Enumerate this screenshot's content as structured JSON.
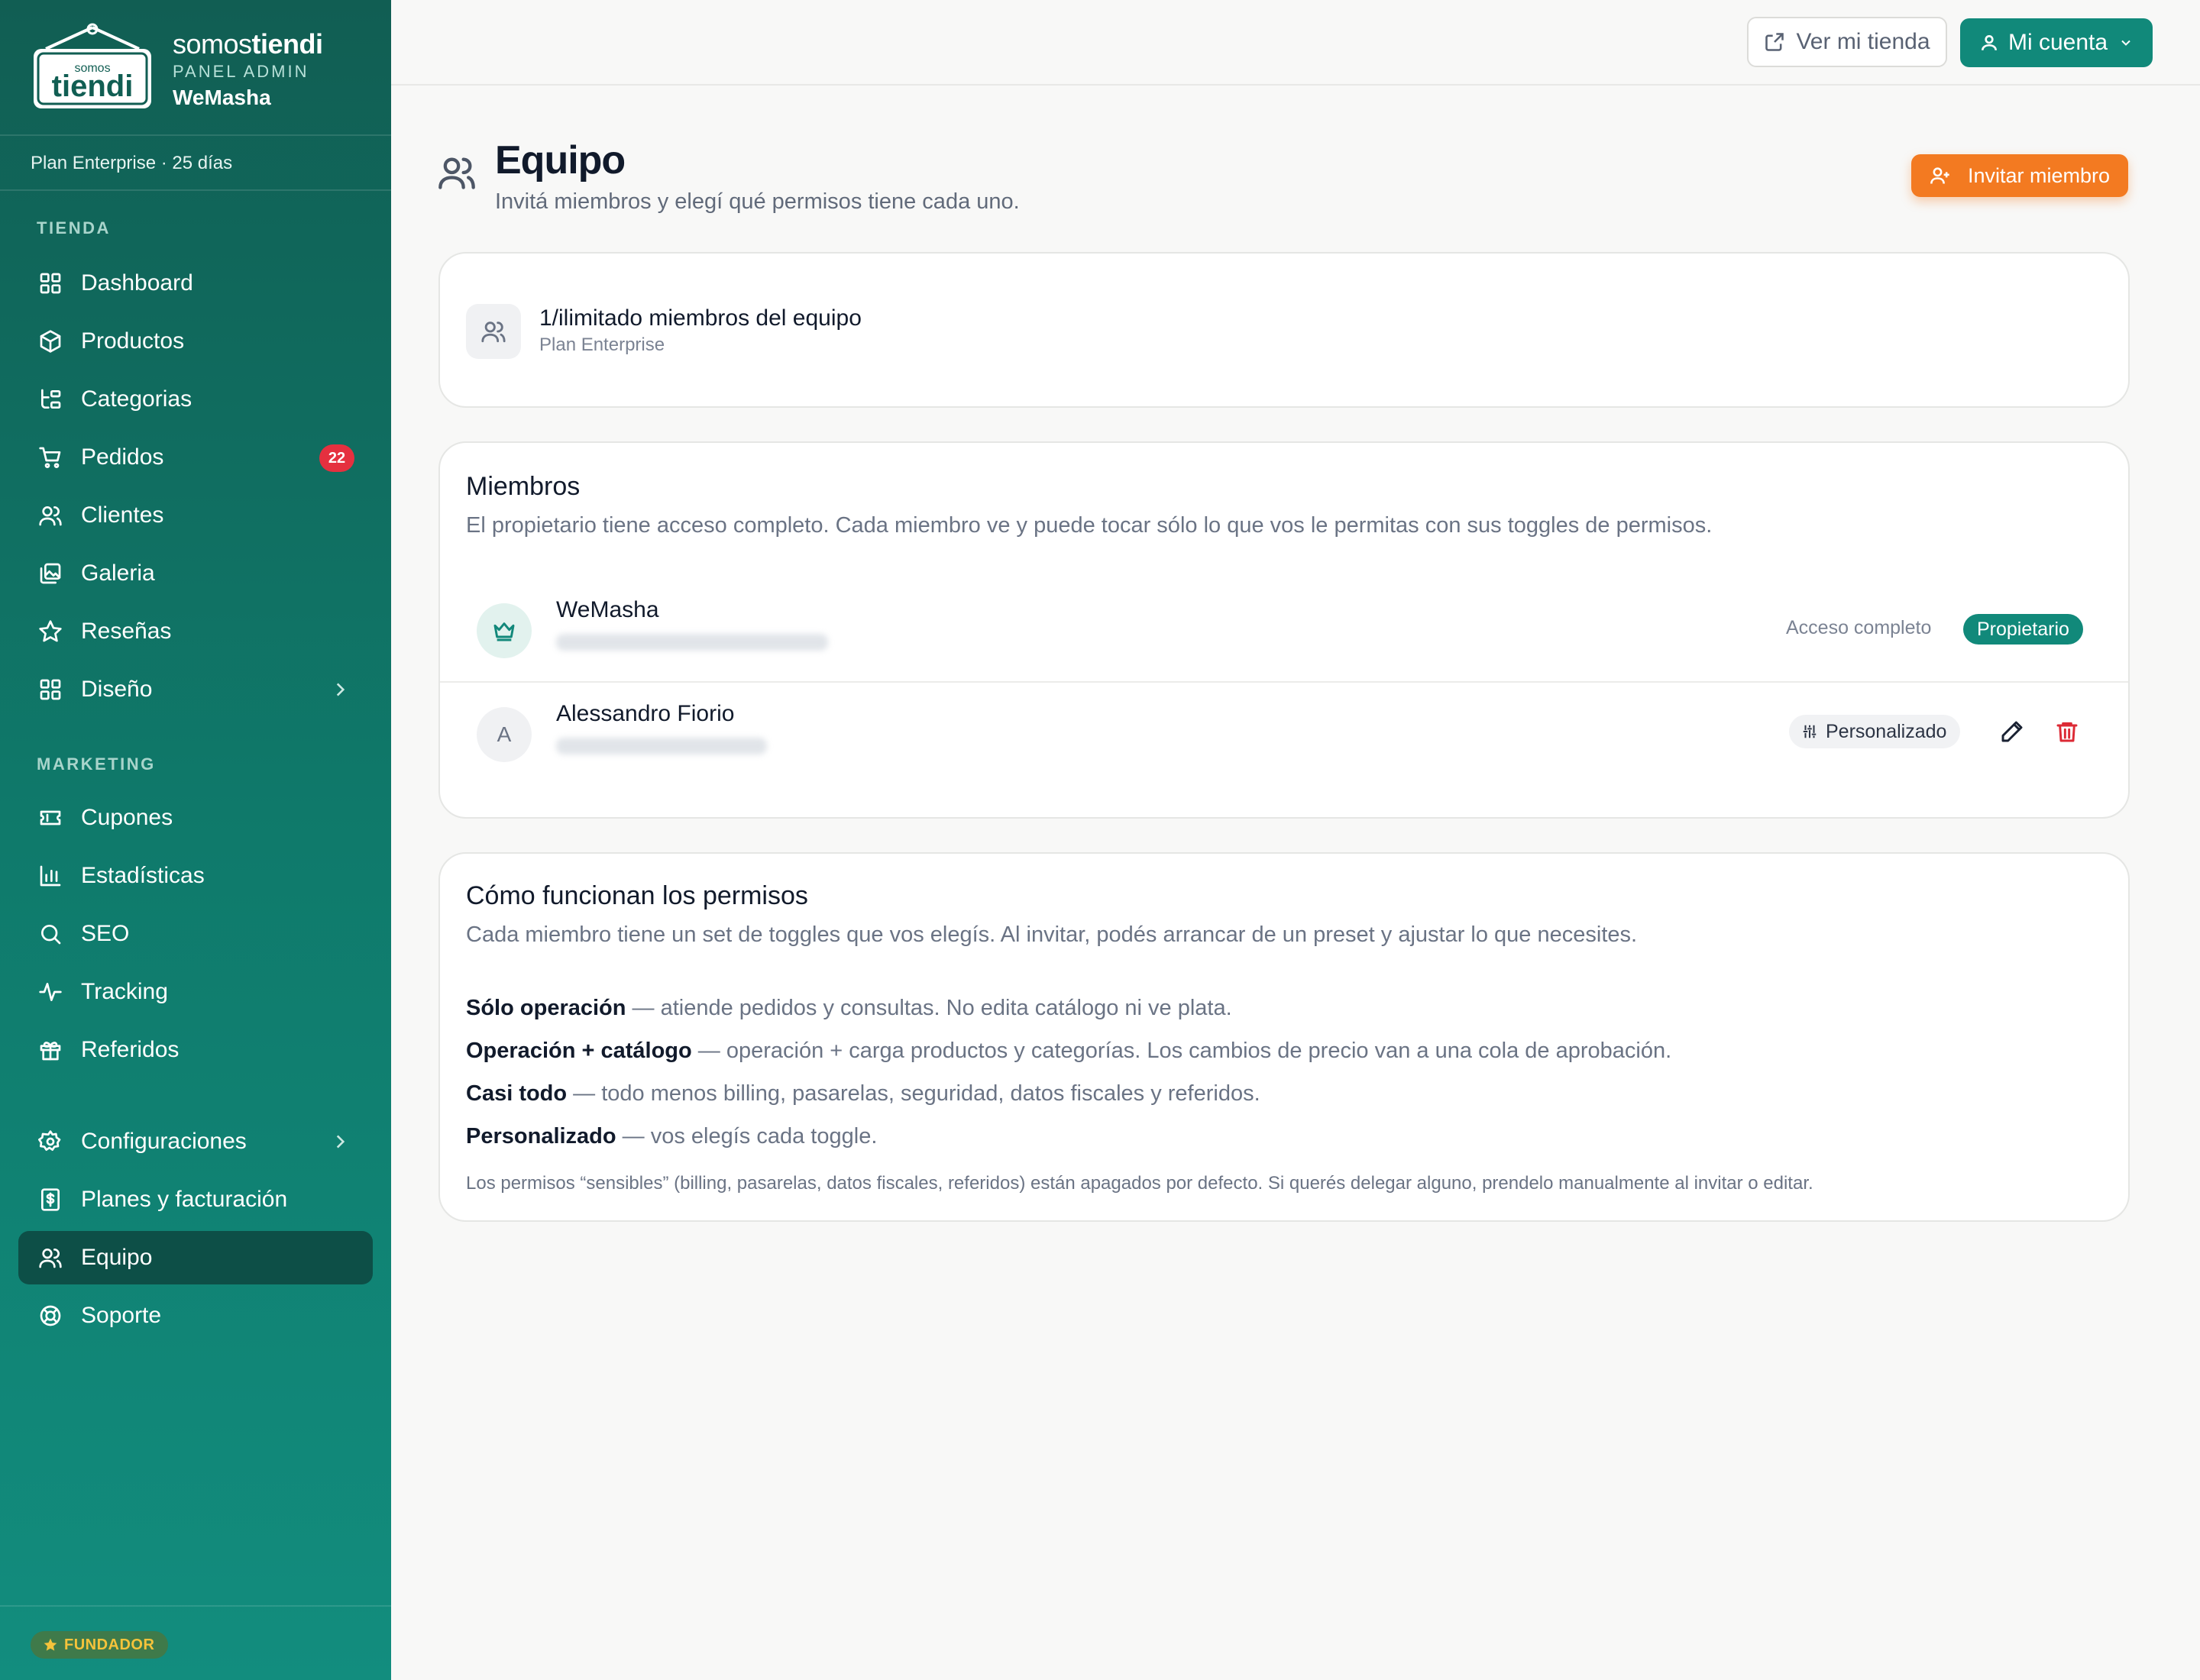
{
  "brand": {
    "logo_small": "somos",
    "logo_big": "tiendi",
    "name_light": "somos",
    "name_bold": "tiendi",
    "subtitle": "PANEL ADMIN",
    "store": "WeMasha"
  },
  "plan_strip": "Plan Enterprise · 25 días",
  "sidebar": {
    "section_store": "TIENDA",
    "section_marketing": "MARKETING",
    "items": [
      {
        "label": "Dashboard",
        "icon": "dashboard-icon"
      },
      {
        "label": "Productos",
        "icon": "box-icon"
      },
      {
        "label": "Categorias",
        "icon": "categories-icon"
      },
      {
        "label": "Pedidos",
        "icon": "cart-icon",
        "badge": "22"
      },
      {
        "label": "Clientes",
        "icon": "users-icon"
      },
      {
        "label": "Galeria",
        "icon": "gallery-icon"
      },
      {
        "label": "Reseñas",
        "icon": "star-icon"
      },
      {
        "label": "Diseño",
        "icon": "layout-icon"
      },
      {
        "label": "Cupones",
        "icon": "ticket-icon"
      },
      {
        "label": "Estadísticas",
        "icon": "chart-icon"
      },
      {
        "label": "SEO",
        "icon": "search-icon"
      },
      {
        "label": "Tracking",
        "icon": "activity-icon"
      },
      {
        "label": "Referidos",
        "icon": "gift-icon"
      },
      {
        "label": "Configuraciones",
        "icon": "gear-icon"
      },
      {
        "label": "Planes y facturación",
        "icon": "receipt-icon"
      },
      {
        "label": "Equipo",
        "icon": "users-icon"
      },
      {
        "label": "Soporte",
        "icon": "lifebuoy-icon"
      }
    ],
    "founder_badge": "FUNDADOR"
  },
  "topbar": {
    "view_store": "Ver mi tienda",
    "account": "Mi cuenta"
  },
  "page": {
    "title": "Equipo",
    "subtitle": "Invitá miembros y elegí qué permisos tiene cada uno.",
    "invite_button": "Invitar miembro"
  },
  "team_summary": {
    "count": "1/ilimitado miembros del equipo",
    "plan": "Plan Enterprise"
  },
  "members": {
    "title": "Miembros",
    "description": "El propietario tiene acceso completo. Cada miembro ve y puede tocar sólo lo que vos le permitas con sus toggles de permisos.",
    "rows": [
      {
        "name": "WeMasha",
        "avatar": "crown-icon",
        "access": "Acceso completo",
        "role": "Propietario"
      },
      {
        "name": "Alessandro Fiorio",
        "avatar": "A",
        "role": "Personalizado"
      }
    ]
  },
  "permissions": {
    "title": "Cómo funcionan los permisos",
    "description": "Cada miembro tiene un set de toggles que vos elegís. Al invitar, podés arrancar de un preset y ajustar lo que necesites.",
    "presets": [
      {
        "name": "Sólo operación",
        "text": " — atiende pedidos y consultas. No edita catálogo ni ve plata."
      },
      {
        "name": "Operación + catálogo",
        "text": " — operación + carga productos y categorías. Los cambios de precio van a una cola de aprobación."
      },
      {
        "name": "Casi todo",
        "text": " — todo menos billing, pasarelas, seguridad, datos fiscales y referidos."
      },
      {
        "name": "Personalizado",
        "text": " — vos elegís cada toggle."
      }
    ],
    "note": "Los permisos “sensibles” (billing, pasarelas, datos fiscales, referidos) están apagados por defecto. Si querés delegar alguno, prendelo manualmente al invitar o editar."
  },
  "colors": {
    "sidebar": "#115e53",
    "accent": "#11897a",
    "invite": "#f37a21",
    "danger": "#dc2a35"
  }
}
